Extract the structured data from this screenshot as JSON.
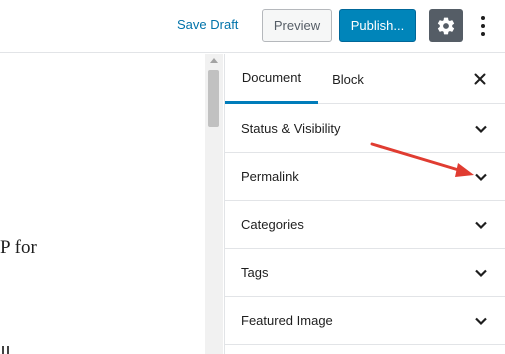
{
  "toolbar": {
    "save_draft_label": "Save Draft",
    "preview_label": "Preview",
    "publish_label": "Publish...",
    "settings_icon": "gear-icon",
    "more_icon": "vertical-ellipsis-icon"
  },
  "editor": {
    "visible_text": "P for"
  },
  "sidebar": {
    "tabs": [
      {
        "label": "Document",
        "active": true
      },
      {
        "label": "Block",
        "active": false
      }
    ],
    "close_icon": "close-icon",
    "panels": [
      {
        "label": "Status & Visibility"
      },
      {
        "label": "Permalink"
      },
      {
        "label": "Categories"
      },
      {
        "label": "Tags"
      },
      {
        "label": "Featured Image"
      }
    ]
  },
  "annotation": {
    "arrow_color": "#e03c31",
    "target": "Permalink"
  },
  "colors": {
    "accent": "#0085ba",
    "link": "#0073aa",
    "tab_underline": "#007cba",
    "settings_bg": "#555d66"
  }
}
